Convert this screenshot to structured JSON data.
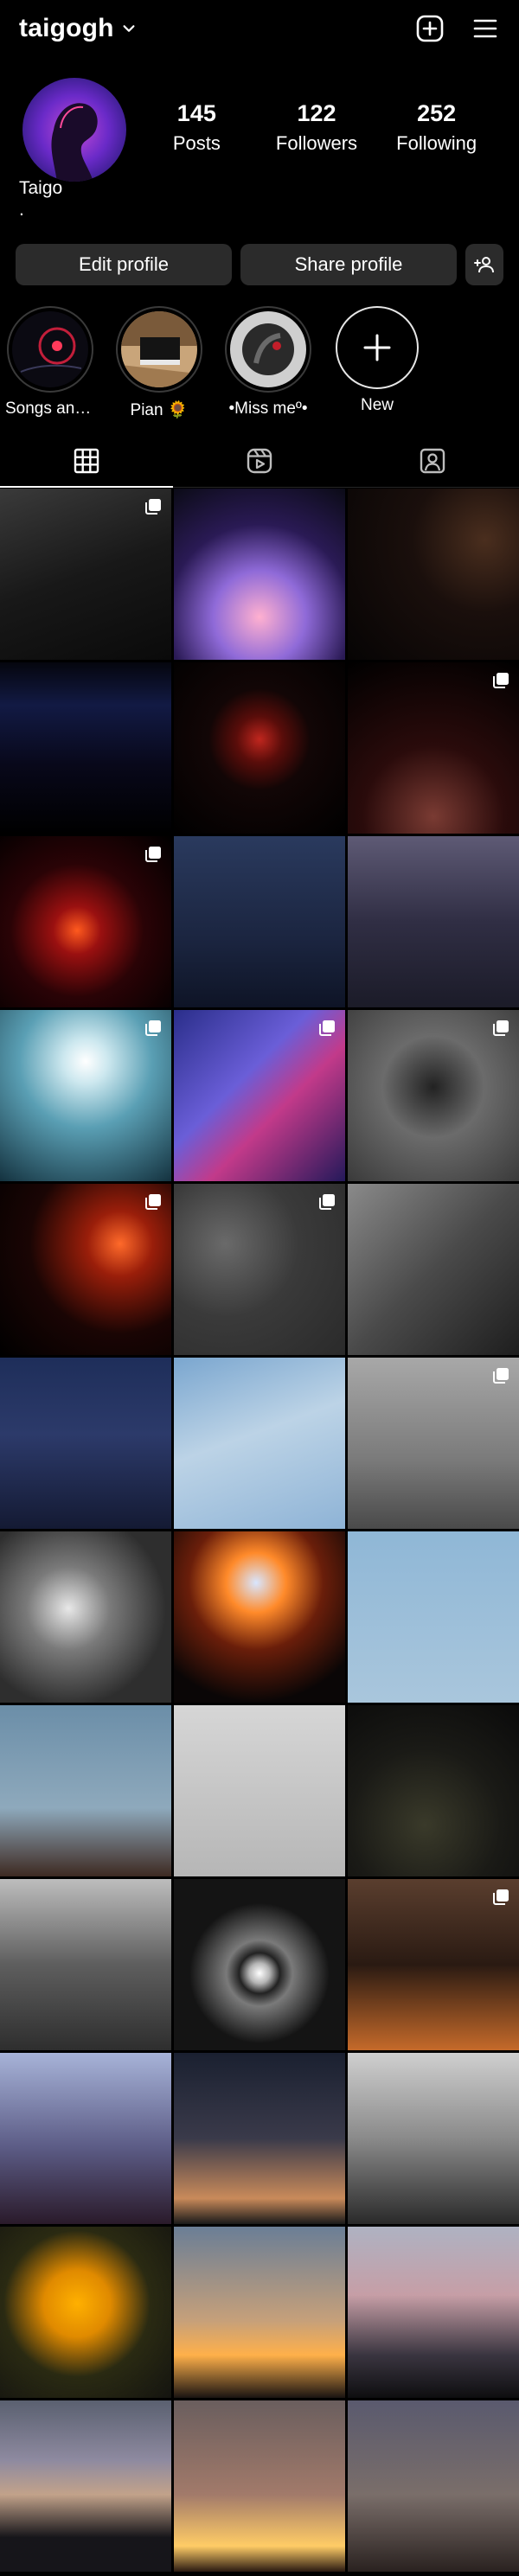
{
  "header": {
    "username": "taigogh",
    "icons": [
      "chevron-down-icon",
      "plus-square-icon",
      "hamburger-menu-icon"
    ]
  },
  "profile": {
    "name": "Taigo",
    "bio": ".",
    "stats": [
      {
        "value": "145",
        "label": "Posts"
      },
      {
        "value": "122",
        "label": "Followers"
      },
      {
        "value": "252",
        "label": "Following"
      }
    ]
  },
  "buttons": {
    "edit": "Edit profile",
    "share": "Share profile",
    "discover_icon": "add-person-icon"
  },
  "highlights": [
    {
      "label": "Songs and O..."
    },
    {
      "label": "Pian 🌻"
    },
    {
      "label": "•Miss meº•"
    },
    {
      "label": "New"
    }
  ],
  "tabs": [
    {
      "name": "posts",
      "icon": "grid-icon",
      "active": true
    },
    {
      "name": "reels",
      "icon": "reels-icon",
      "active": false
    },
    {
      "name": "tagged",
      "icon": "tagged-person-icon",
      "active": false
    }
  ],
  "colors": {
    "background": "#000000",
    "button": "#2b2b2b",
    "text": "#ffffff",
    "divider": "#262626"
  }
}
